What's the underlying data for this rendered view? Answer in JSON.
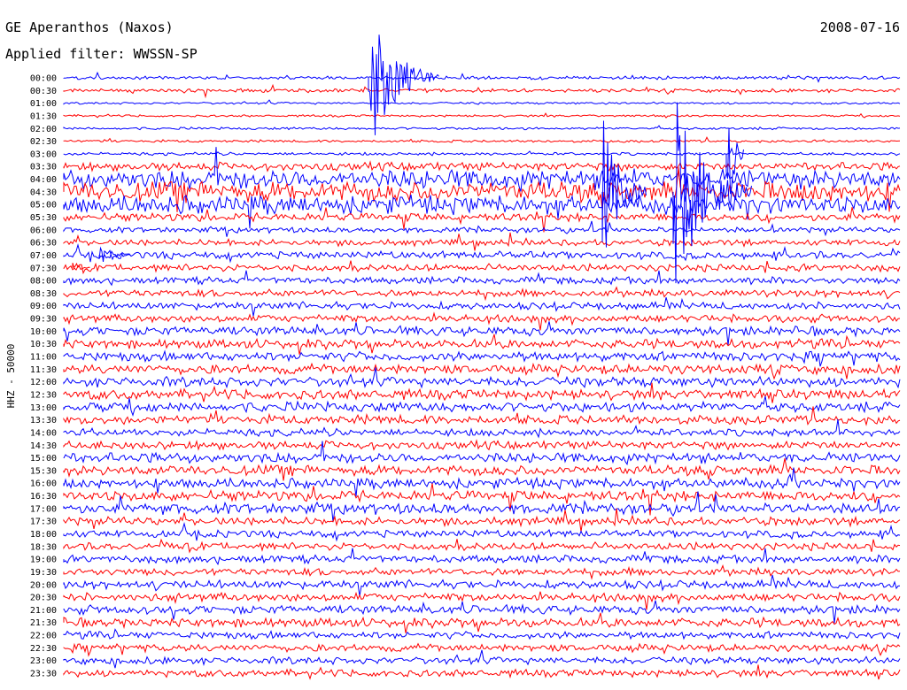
{
  "chart_data": {
    "type": "line",
    "title": "GE Aperanthos (Naxos)",
    "subtitle": "Applied filter: WWSSN-SP",
    "date": "2008-07-16",
    "ylabel": "HHZ - 50000",
    "colors": [
      "#0000ff",
      "#ff0000"
    ],
    "grid": false,
    "rows": [
      {
        "label": "00:00",
        "level": 0.08
      },
      {
        "label": "00:30",
        "level": 0.1
      },
      {
        "label": "01:00",
        "level": 0.02
      },
      {
        "label": "01:30",
        "level": 0.02
      },
      {
        "label": "02:00",
        "level": 0.04
      },
      {
        "label": "02:30",
        "level": 0.04
      },
      {
        "label": "03:00",
        "level": 0.06
      },
      {
        "label": "03:30",
        "level": 0.35
      },
      {
        "label": "04:00",
        "level": 0.95
      },
      {
        "label": "04:30",
        "level": 1.0
      },
      {
        "label": "05:00",
        "level": 0.9
      },
      {
        "label": "05:30",
        "level": 0.35
      },
      {
        "label": "06:00",
        "level": 0.2
      },
      {
        "label": "06:30",
        "level": 0.25
      },
      {
        "label": "07:00",
        "level": 0.3
      },
      {
        "label": "07:30",
        "level": 0.3
      },
      {
        "label": "08:00",
        "level": 0.28
      },
      {
        "label": "08:30",
        "level": 0.3
      },
      {
        "label": "09:00",
        "level": 0.3
      },
      {
        "label": "09:30",
        "level": 0.32
      },
      {
        "label": "10:00",
        "level": 0.4
      },
      {
        "label": "10:30",
        "level": 0.4
      },
      {
        "label": "11:00",
        "level": 0.42
      },
      {
        "label": "11:30",
        "level": 0.42
      },
      {
        "label": "12:00",
        "level": 0.45
      },
      {
        "label": "12:30",
        "level": 0.45
      },
      {
        "label": "13:00",
        "level": 0.45
      },
      {
        "label": "13:30",
        "level": 0.4
      },
      {
        "label": "14:00",
        "level": 0.3
      },
      {
        "label": "14:30",
        "level": 0.35
      },
      {
        "label": "15:00",
        "level": 0.45
      },
      {
        "label": "15:30",
        "level": 0.45
      },
      {
        "label": "16:00",
        "level": 0.45
      },
      {
        "label": "16:30",
        "level": 0.48
      },
      {
        "label": "17:00",
        "level": 0.48
      },
      {
        "label": "17:30",
        "level": 0.35
      },
      {
        "label": "18:00",
        "level": 0.3
      },
      {
        "label": "18:30",
        "level": 0.32
      },
      {
        "label": "19:00",
        "level": 0.32
      },
      {
        "label": "19:30",
        "level": 0.32
      },
      {
        "label": "20:00",
        "level": 0.35
      },
      {
        "label": "20:30",
        "level": 0.35
      },
      {
        "label": "21:00",
        "level": 0.38
      },
      {
        "label": "21:30",
        "level": 0.4
      },
      {
        "label": "22:00",
        "level": 0.3
      },
      {
        "label": "22:30",
        "level": 0.3
      },
      {
        "label": "23:00",
        "level": 0.3
      },
      {
        "label": "23:30",
        "level": 0.3
      }
    ]
  }
}
